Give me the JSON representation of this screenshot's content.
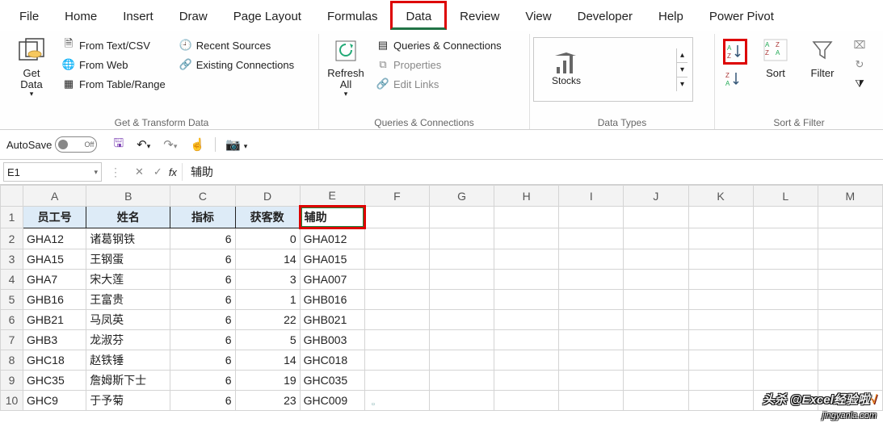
{
  "tabs": {
    "file": "File",
    "home": "Home",
    "insert": "Insert",
    "draw": "Draw",
    "page_layout": "Page Layout",
    "formulas": "Formulas",
    "data": "Data",
    "review": "Review",
    "view": "View",
    "developer": "Developer",
    "help": "Help",
    "power_pivot": "Power Pivot"
  },
  "ribbon": {
    "get_data": "Get\nData",
    "from_text_csv": "From Text/CSV",
    "from_web": "From Web",
    "from_table_range": "From Table/Range",
    "recent_sources": "Recent Sources",
    "existing_connections": "Existing Connections",
    "group_get_transform": "Get & Transform Data",
    "refresh_all": "Refresh\nAll",
    "queries_connections": "Queries & Connections",
    "properties": "Properties",
    "edit_links": "Edit Links",
    "group_queries": "Queries & Connections",
    "datatype_stocks": "Stocks",
    "group_datatypes": "Data Types",
    "sort_asc": "A→Z",
    "sort_desc": "Z→A",
    "sort": "Sort",
    "filter": "Filter",
    "clear": "",
    "reapply": "",
    "advanced": "",
    "group_sort_filter": "Sort & Filter"
  },
  "qat": {
    "autosave_label": "AutoSave",
    "autosave_state": "Off"
  },
  "formula_bar": {
    "namebox": "E1",
    "fx": "fx",
    "formula_value": "辅助"
  },
  "columns": [
    "A",
    "B",
    "C",
    "D",
    "E",
    "F",
    "G",
    "H",
    "I",
    "J",
    "K",
    "L",
    "M"
  ],
  "user_headers": {
    "a": "员工号",
    "b": "姓名",
    "c": "指标",
    "d": "获客数",
    "e": "辅助"
  },
  "rows": [
    {
      "a": "GHA12",
      "b": "诸葛钢铁",
      "c": 6,
      "d": 0,
      "e": "GHA012"
    },
    {
      "a": "GHA15",
      "b": "王钢蛋",
      "c": 6,
      "d": 14,
      "e": "GHA015"
    },
    {
      "a": "GHA7",
      "b": "宋大莲",
      "c": 6,
      "d": 3,
      "e": "GHA007"
    },
    {
      "a": "GHB16",
      "b": "王富贵",
      "c": 6,
      "d": 1,
      "e": "GHB016"
    },
    {
      "a": "GHB21",
      "b": "马凤英",
      "c": 6,
      "d": 22,
      "e": "GHB021"
    },
    {
      "a": "GHB3",
      "b": "龙淑芬",
      "c": 6,
      "d": 5,
      "e": "GHB003"
    },
    {
      "a": "GHC18",
      "b": "赵铁锤",
      "c": 6,
      "d": 14,
      "e": "GHC018"
    },
    {
      "a": "GHC35",
      "b": "詹姆斯下士",
      "c": 6,
      "d": 19,
      "e": "GHC035"
    },
    {
      "a": "GHC9",
      "b": "于予菊",
      "c": 6,
      "d": 23,
      "e": "GHC009"
    }
  ],
  "watermark": {
    "main": "头杀 @Excel经验啦",
    "check": "√",
    "sub": "jingyanla.com"
  }
}
